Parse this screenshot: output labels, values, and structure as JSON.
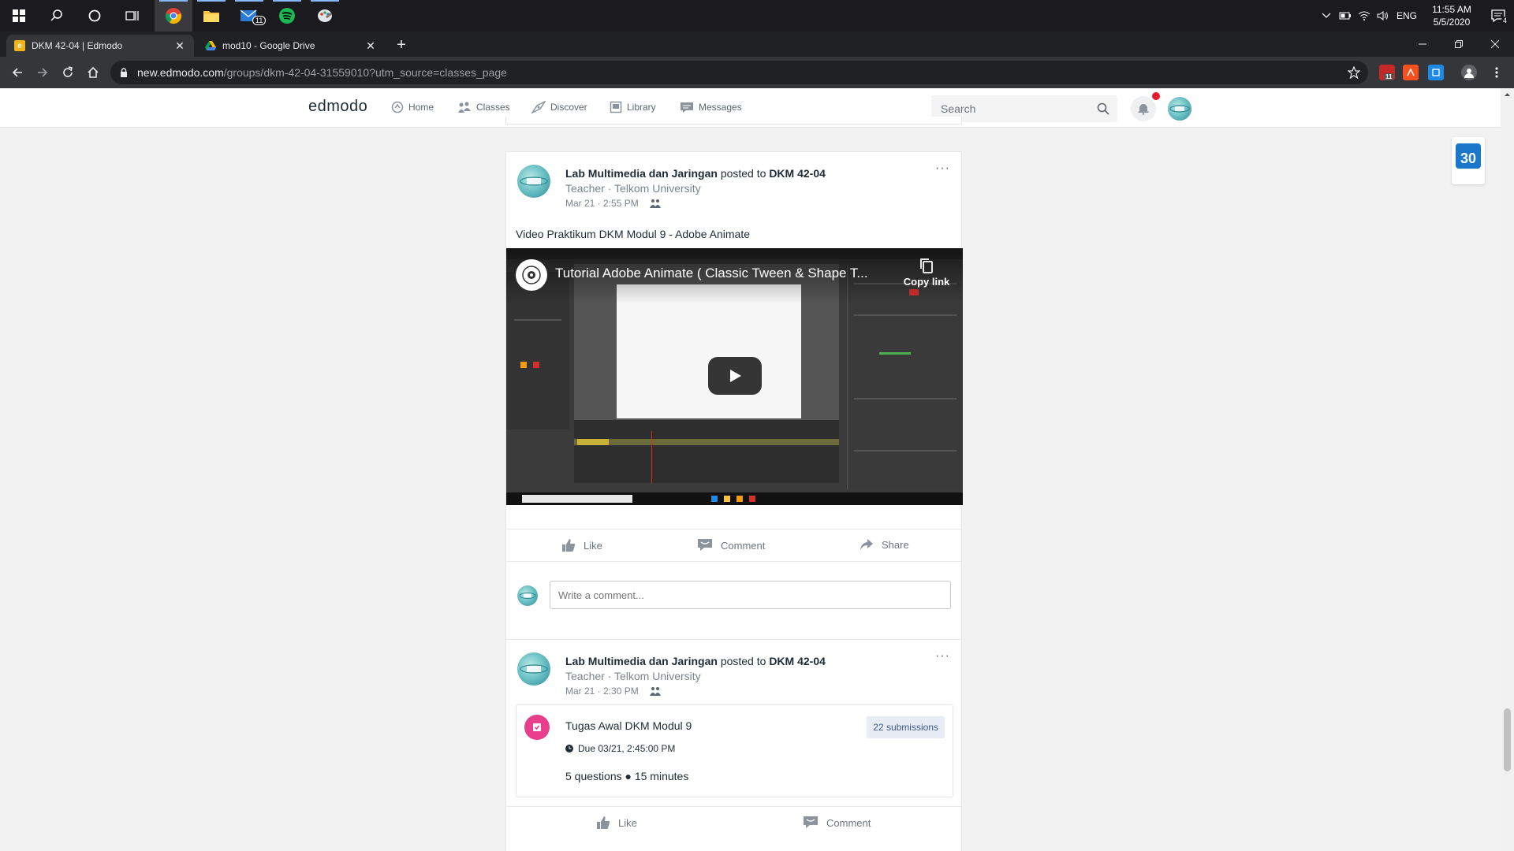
{
  "taskbar": {
    "apps": [
      "start",
      "search",
      "cortana",
      "task-view",
      "chrome",
      "file-explorer",
      "mail",
      "spotify",
      "paint"
    ],
    "mail_badge": "11",
    "lang": "ENG",
    "time": "11:55 AM",
    "date": "5/5/2020",
    "notifications": "4"
  },
  "browser": {
    "tabs": [
      {
        "title": "DKM 42-04 | Edmodo",
        "favicon": "edmodo",
        "active": true
      },
      {
        "title": "mod10 - Google Drive",
        "favicon": "google-drive",
        "active": false
      }
    ],
    "url_host": "new.edmodo.com",
    "url_path": "/groups/dkm-42-04-31559010?utm_source=classes_page",
    "extension_badge": "11"
  },
  "app": {
    "logo": "edmodo",
    "nav": [
      {
        "label": "Home",
        "icon": "home-icon"
      },
      {
        "label": "Classes",
        "icon": "classes-icon"
      },
      {
        "label": "Discover",
        "icon": "discover-icon"
      },
      {
        "label": "Library",
        "icon": "library-icon"
      },
      {
        "label": "Messages",
        "icon": "messages-icon"
      }
    ],
    "search_placeholder": "Search",
    "calendar_day": "30"
  },
  "posts": [
    {
      "author": "Lab Multimedia dan Jaringan",
      "posted_to_text": "posted to",
      "group": "DKM 42-04",
      "role": "Teacher · Telkom University",
      "timestamp": "Mar 21 · 2:55 PM",
      "text": "Video Praktikum DKM Modul 9 - Adobe Animate",
      "video": {
        "title": "Tutorial Adobe Animate ( Classic Tween & Shape T...",
        "copy_link": "Copy link"
      },
      "actions": {
        "like": "Like",
        "comment": "Comment",
        "share": "Share"
      },
      "comment_placeholder": "Write a comment..."
    },
    {
      "author": "Lab Multimedia dan Jaringan",
      "posted_to_text": "posted to",
      "group": "DKM 42-04",
      "role": "Teacher · Telkom University",
      "timestamp": "Mar 21 · 2:30 PM",
      "assignment": {
        "title": "Tugas Awal DKM Modul 9",
        "due": "Due 03/21, 2:45:00 PM",
        "details": "5 questions ● 15 minutes",
        "submissions": "22 submissions"
      },
      "actions": {
        "like": "Like",
        "comment": "Comment"
      }
    }
  ],
  "colors": {
    "taskbar": "#1b1b1f",
    "chrome_frame": "#202124",
    "chrome_toolbar": "#35363a",
    "page_bg": "#f2f2f2",
    "assignment_accent": "#e83e8c",
    "notification_dot": "#e8192c",
    "calendar_blue": "#1a77c9"
  }
}
